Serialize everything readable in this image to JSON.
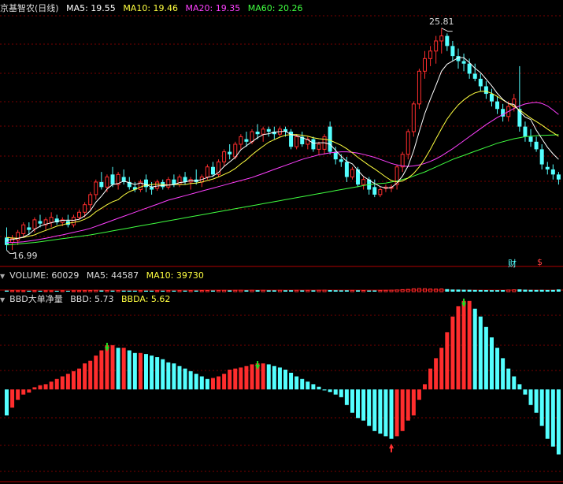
{
  "main": {
    "title": "京基智农(日线)",
    "ma5": "MA5: 19.55",
    "ma10": "MA10: 19.46",
    "ma20": "MA20: 19.35",
    "ma60": "MA60: 20.26",
    "high_label": "25.81",
    "low_label": "16.99",
    "badge_cai": "财",
    "badge_dollar": "$"
  },
  "volume": {
    "label": "VOLUME: 60029",
    "ma5": "MA5: 44587",
    "ma10": "MA10: 39730"
  },
  "bbd": {
    "title": "BBD大单净量",
    "bbd": "BBD: 5.73",
    "bbda": "BBDA: 5.62"
  },
  "colors": {
    "up": "#ff2d2d",
    "down": "#54ffff",
    "ma5": "#ffffff",
    "ma10": "#ffff40",
    "ma20": "#ff40ff",
    "ma60": "#40ff40",
    "grid": "#7a0000"
  },
  "chart_data": [
    {
      "type": "candlestick",
      "ylim": [
        16.6,
        26.3
      ],
      "ohlc": [
        [
          17.5,
          17.9,
          16.99,
          17.2
        ],
        [
          17.3,
          17.6,
          17.0,
          17.45
        ],
        [
          17.4,
          17.8,
          17.2,
          17.7
        ],
        [
          17.65,
          18.1,
          17.5,
          18.0
        ],
        [
          17.9,
          18.1,
          17.6,
          17.8
        ],
        [
          17.85,
          18.3,
          17.7,
          18.2
        ],
        [
          18.15,
          18.4,
          17.9,
          18.05
        ],
        [
          18.0,
          18.3,
          17.8,
          18.2
        ],
        [
          18.1,
          18.5,
          17.9,
          18.3
        ],
        [
          18.25,
          18.4,
          18.0,
          18.1
        ],
        [
          18.1,
          18.3,
          17.95,
          18.2
        ],
        [
          18.15,
          18.4,
          17.9,
          18.0
        ],
        [
          18.0,
          18.4,
          17.9,
          18.3
        ],
        [
          18.3,
          18.6,
          18.2,
          18.5
        ],
        [
          18.5,
          18.9,
          18.3,
          18.8
        ],
        [
          18.8,
          19.3,
          18.6,
          19.2
        ],
        [
          19.2,
          19.8,
          19.0,
          19.7
        ],
        [
          19.7,
          20.1,
          19.4,
          19.5
        ],
        [
          19.5,
          20.0,
          19.3,
          19.9
        ],
        [
          20.0,
          20.3,
          19.5,
          19.6
        ],
        [
          19.6,
          20.1,
          19.4,
          20.0
        ],
        [
          19.9,
          20.2,
          19.6,
          19.7
        ],
        [
          19.7,
          19.9,
          19.4,
          19.5
        ],
        [
          19.5,
          19.7,
          19.3,
          19.4
        ],
        [
          19.4,
          19.8,
          19.3,
          19.7
        ],
        [
          19.8,
          20.0,
          19.3,
          19.5
        ],
        [
          19.5,
          19.7,
          19.2,
          19.4
        ],
        [
          19.45,
          19.8,
          19.35,
          19.7
        ],
        [
          19.7,
          19.8,
          19.4,
          19.5
        ],
        [
          19.5,
          19.9,
          19.4,
          19.8
        ],
        [
          19.8,
          20.0,
          19.5,
          19.6
        ],
        [
          19.6,
          20.0,
          19.5,
          19.9
        ],
        [
          19.9,
          20.1,
          19.6,
          19.7
        ],
        [
          19.7,
          19.9,
          19.4,
          19.8
        ],
        [
          19.8,
          20.2,
          19.6,
          19.7
        ],
        [
          19.7,
          20.0,
          19.5,
          19.9
        ],
        [
          19.9,
          20.4,
          19.8,
          20.3
        ],
        [
          20.3,
          20.5,
          19.9,
          20.0
        ],
        [
          20.0,
          20.6,
          19.9,
          20.5
        ],
        [
          20.5,
          21.0,
          20.3,
          20.9
        ],
        [
          20.9,
          21.2,
          20.6,
          20.8
        ],
        [
          20.7,
          21.3,
          20.6,
          21.2
        ],
        [
          21.2,
          21.6,
          21.0,
          21.5
        ],
        [
          21.4,
          21.7,
          21.1,
          21.3
        ],
        [
          21.3,
          21.8,
          21.2,
          21.7
        ],
        [
          21.7,
          22.0,
          21.4,
          21.6
        ],
        [
          21.6,
          21.9,
          21.3,
          21.8
        ],
        [
          21.8,
          21.9,
          21.5,
          21.7
        ],
        [
          21.7,
          21.9,
          21.4,
          21.6
        ],
        [
          21.6,
          21.9,
          21.5,
          21.8
        ],
        [
          21.8,
          21.9,
          21.5,
          21.7
        ],
        [
          21.7,
          21.8,
          21.0,
          21.1
        ],
        [
          21.1,
          21.6,
          21.0,
          21.5
        ],
        [
          21.5,
          21.7,
          21.1,
          21.2
        ],
        [
          21.2,
          21.5,
          21.0,
          21.4
        ],
        [
          21.4,
          21.5,
          20.9,
          21.0
        ],
        [
          21.0,
          21.3,
          20.8,
          21.2
        ],
        [
          21.0,
          21.6,
          20.8,
          21.5
        ],
        [
          21.9,
          22.1,
          20.8,
          20.9
        ],
        [
          20.9,
          21.1,
          20.4,
          20.6
        ],
        [
          20.6,
          20.8,
          20.3,
          20.5
        ],
        [
          20.5,
          20.7,
          19.7,
          19.9
        ],
        [
          19.9,
          20.3,
          19.8,
          20.2
        ],
        [
          20.2,
          20.3,
          19.5,
          19.6
        ],
        [
          19.6,
          19.9,
          19.4,
          19.8
        ],
        [
          19.8,
          19.9,
          19.2,
          19.4
        ],
        [
          19.5,
          19.8,
          19.1,
          19.2
        ],
        [
          19.2,
          19.5,
          19.1,
          19.4
        ],
        [
          19.45,
          19.6,
          19.3,
          19.5
        ],
        [
          19.45,
          19.6,
          19.3,
          19.5
        ],
        [
          19.6,
          20.4,
          19.4,
          20.3
        ],
        [
          20.3,
          20.9,
          20.1,
          20.8
        ],
        [
          20.8,
          21.8,
          20.6,
          21.7
        ],
        [
          21.7,
          22.9,
          21.5,
          22.8
        ],
        [
          22.8,
          24.2,
          22.6,
          24.1
        ],
        [
          24.1,
          24.9,
          23.8,
          24.6
        ],
        [
          24.6,
          25.1,
          24.3,
          24.9
        ],
        [
          24.9,
          25.5,
          24.4,
          25.3
        ],
        [
          25.3,
          25.81,
          24.8,
          25.5
        ],
        [
          25.5,
          25.6,
          24.9,
          25.1
        ],
        [
          25.1,
          25.3,
          24.5,
          24.7
        ],
        [
          24.7,
          25.0,
          24.2,
          24.5
        ],
        [
          24.5,
          24.8,
          24.1,
          24.4
        ],
        [
          24.4,
          24.6,
          23.8,
          24.0
        ],
        [
          24.0,
          24.4,
          23.7,
          23.8
        ],
        [
          23.8,
          24.0,
          23.3,
          23.5
        ],
        [
          23.5,
          23.7,
          23.0,
          23.2
        ],
        [
          23.2,
          23.4,
          22.7,
          22.9
        ],
        [
          22.9,
          23.1,
          22.4,
          22.6
        ],
        [
          22.6,
          22.8,
          22.1,
          22.3
        ],
        [
          22.3,
          22.9,
          22.1,
          22.7
        ],
        [
          22.7,
          23.2,
          22.5,
          23.0
        ],
        [
          22.6,
          24.3,
          21.7,
          21.9
        ],
        [
          21.9,
          22.1,
          21.3,
          21.5
        ],
        [
          21.5,
          21.8,
          21.1,
          21.3
        ],
        [
          21.3,
          21.5,
          20.9,
          21.0
        ],
        [
          21.0,
          21.2,
          20.2,
          20.4
        ],
        [
          20.3,
          20.5,
          20.0,
          20.2
        ],
        [
          20.2,
          20.4,
          19.8,
          20.0
        ],
        [
          20.0,
          20.1,
          19.6,
          19.8
        ]
      ],
      "ma5": [
        17.4,
        17.42,
        17.46,
        17.52,
        17.63,
        17.82,
        17.95,
        18.03,
        18.08,
        18.14,
        18.18,
        18.19,
        18.18,
        18.22,
        18.36,
        18.56,
        18.9,
        19.14,
        19.42,
        19.6,
        19.64,
        19.74,
        19.67,
        19.6,
        19.66,
        19.6,
        19.5,
        19.54,
        19.56,
        19.58,
        19.6,
        19.68,
        19.7,
        19.76,
        19.74,
        19.8,
        19.88,
        19.94,
        20.08,
        20.32,
        20.5,
        20.68,
        20.98,
        21.14,
        21.3,
        21.46,
        21.58,
        21.62,
        21.68,
        21.7,
        21.72,
        21.58,
        21.54,
        21.46,
        21.38,
        21.24,
        21.26,
        21.26,
        21.2,
        20.96,
        20.72,
        20.52,
        20.42,
        20.16,
        19.92,
        19.78,
        19.64,
        19.52,
        19.46,
        19.48,
        19.66,
        19.94,
        20.34,
        20.94,
        21.7,
        22.42,
        23.0,
        23.54,
        24.1,
        24.38,
        24.5,
        24.64,
        24.64,
        24.44,
        24.22,
        24.04,
        23.78,
        23.52,
        23.22,
        22.98,
        22.82,
        22.78,
        22.5,
        22.28,
        22.18,
        21.76,
        21.42,
        21.08,
        20.82,
        20.6
      ],
      "ma10": [
        17.5,
        17.48,
        17.47,
        17.5,
        17.55,
        17.6,
        17.7,
        17.78,
        17.86,
        17.95,
        18.0,
        18.06,
        18.1,
        18.14,
        18.22,
        18.34,
        18.52,
        18.66,
        18.8,
        18.92,
        19.0,
        19.18,
        19.32,
        19.4,
        19.5,
        19.58,
        19.6,
        19.62,
        19.6,
        19.58,
        19.6,
        19.6,
        19.6,
        19.64,
        19.66,
        19.7,
        19.76,
        19.82,
        19.9,
        20.0,
        20.1,
        20.24,
        20.42,
        20.58,
        20.78,
        20.96,
        21.12,
        21.28,
        21.38,
        21.48,
        21.56,
        21.58,
        21.58,
        21.56,
        21.52,
        21.46,
        21.42,
        21.4,
        21.36,
        21.26,
        21.16,
        21.02,
        20.86,
        20.68,
        20.52,
        20.36,
        20.22,
        20.06,
        19.9,
        19.76,
        19.7,
        19.74,
        19.86,
        20.04,
        20.3,
        20.62,
        21.0,
        21.42,
        21.82,
        22.2,
        22.5,
        22.76,
        22.96,
        23.12,
        23.24,
        23.3,
        23.3,
        23.22,
        23.1,
        22.96,
        22.82,
        22.7,
        22.56,
        22.4,
        22.24,
        22.1,
        21.96,
        21.8,
        21.66,
        21.52
      ],
      "ma20": [
        17.3,
        17.3,
        17.31,
        17.33,
        17.36,
        17.39,
        17.43,
        17.47,
        17.51,
        17.56,
        17.6,
        17.65,
        17.7,
        17.75,
        17.8,
        17.86,
        17.94,
        18.02,
        18.1,
        18.18,
        18.26,
        18.34,
        18.42,
        18.5,
        18.58,
        18.66,
        18.74,
        18.82,
        18.9,
        18.98,
        19.04,
        19.1,
        19.16,
        19.22,
        19.28,
        19.34,
        19.4,
        19.46,
        19.52,
        19.58,
        19.64,
        19.7,
        19.76,
        19.82,
        19.88,
        19.96,
        20.04,
        20.12,
        20.2,
        20.28,
        20.36,
        20.44,
        20.52,
        20.6,
        20.66,
        20.72,
        20.78,
        20.82,
        20.86,
        20.88,
        20.9,
        20.9,
        20.88,
        20.85,
        20.8,
        20.74,
        20.68,
        20.6,
        20.52,
        20.44,
        20.38,
        20.34,
        20.32,
        20.34,
        20.38,
        20.44,
        20.52,
        20.62,
        20.74,
        20.88,
        21.02,
        21.18,
        21.34,
        21.5,
        21.66,
        21.82,
        21.98,
        22.12,
        22.26,
        22.38,
        22.5,
        22.62,
        22.72,
        22.8,
        22.84,
        22.86,
        22.82,
        22.72,
        22.56,
        22.38
      ],
      "ma60": [
        17.2,
        17.22,
        17.24,
        17.26,
        17.28,
        17.3,
        17.33,
        17.36,
        17.39,
        17.42,
        17.45,
        17.48,
        17.51,
        17.54,
        17.57,
        17.6,
        17.64,
        17.68,
        17.72,
        17.76,
        17.8,
        17.84,
        17.88,
        17.92,
        17.96,
        18.0,
        18.04,
        18.08,
        18.12,
        18.16,
        18.2,
        18.24,
        18.28,
        18.32,
        18.36,
        18.4,
        18.44,
        18.48,
        18.52,
        18.56,
        18.6,
        18.64,
        18.68,
        18.72,
        18.76,
        18.8,
        18.84,
        18.88,
        18.92,
        18.96,
        19.0,
        19.04,
        19.08,
        19.12,
        19.16,
        19.2,
        19.24,
        19.28,
        19.32,
        19.36,
        19.4,
        19.44,
        19.48,
        19.52,
        19.56,
        19.6,
        19.62,
        19.64,
        19.66,
        19.7,
        19.74,
        19.8,
        19.86,
        19.94,
        20.02,
        20.1,
        20.2,
        20.3,
        20.4,
        20.5,
        20.6,
        20.68,
        20.76,
        20.84,
        20.92,
        21.0,
        21.08,
        21.16,
        21.24,
        21.3,
        21.36,
        21.42,
        21.46,
        21.5,
        21.52,
        21.54,
        21.55,
        21.56,
        21.57,
        21.58
      ]
    },
    {
      "type": "bar",
      "series": [
        {
          "name": "VOLUME",
          "values": [
            30,
            27,
            25,
            24,
            25,
            26,
            25,
            24,
            23,
            24,
            25,
            24,
            24,
            26,
            28,
            31,
            36,
            33,
            30,
            29,
            30,
            29,
            28,
            27,
            27,
            28,
            27,
            26,
            27,
            28,
            28,
            28,
            29,
            29,
            30,
            30,
            32,
            31,
            33,
            36,
            35,
            36,
            38,
            36,
            38,
            39,
            37,
            36,
            36,
            36,
            37,
            38,
            36,
            35,
            35,
            36,
            37,
            40,
            42,
            38,
            36,
            37,
            35,
            36,
            33,
            32,
            33,
            34,
            36,
            40,
            46,
            55,
            62,
            78,
            85,
            80,
            72,
            70,
            74,
            68,
            58,
            56,
            52,
            50,
            46,
            44,
            42,
            40,
            40,
            42,
            44,
            50,
            62,
            53,
            48,
            46,
            48,
            45,
            47,
            60
          ]
        }
      ],
      "ylim": [
        0,
        300
      ]
    },
    {
      "type": "bar",
      "series": [
        {
          "name": "BBD",
          "values": [
            -5,
            -3.5,
            -2,
            -1,
            -0.6,
            0.4,
            0.8,
            1,
            1.5,
            2,
            2.5,
            3,
            3.5,
            4,
            5,
            5.5,
            6.5,
            7.5,
            8.5,
            8.5,
            8,
            8,
            7.5,
            7,
            7,
            6.8,
            6.5,
            6.2,
            5.8,
            5.2,
            5,
            4.5,
            4,
            3.5,
            3,
            2.5,
            2,
            2.2,
            2.5,
            3,
            3.8,
            4,
            4.2,
            4.5,
            4.8,
            5,
            5,
            4.8,
            4.5,
            4.2,
            3.8,
            3.2,
            2.5,
            2,
            1.5,
            1,
            0.5,
            -0.2,
            -0.5,
            -1,
            -1.5,
            -3,
            -4.5,
            -5.5,
            -6,
            -7,
            -8,
            -8.5,
            -9,
            -9.5,
            -9,
            -8,
            -6,
            -5,
            -2,
            1,
            4,
            6,
            8,
            11,
            14,
            16,
            17,
            17,
            15.5,
            14,
            12,
            10,
            8,
            6,
            4,
            2.5,
            1,
            -1,
            -3,
            -4.5,
            -7,
            -9.5,
            -11,
            -12.5
          ]
        }
      ],
      "ylim": [
        -18,
        18
      ]
    }
  ]
}
